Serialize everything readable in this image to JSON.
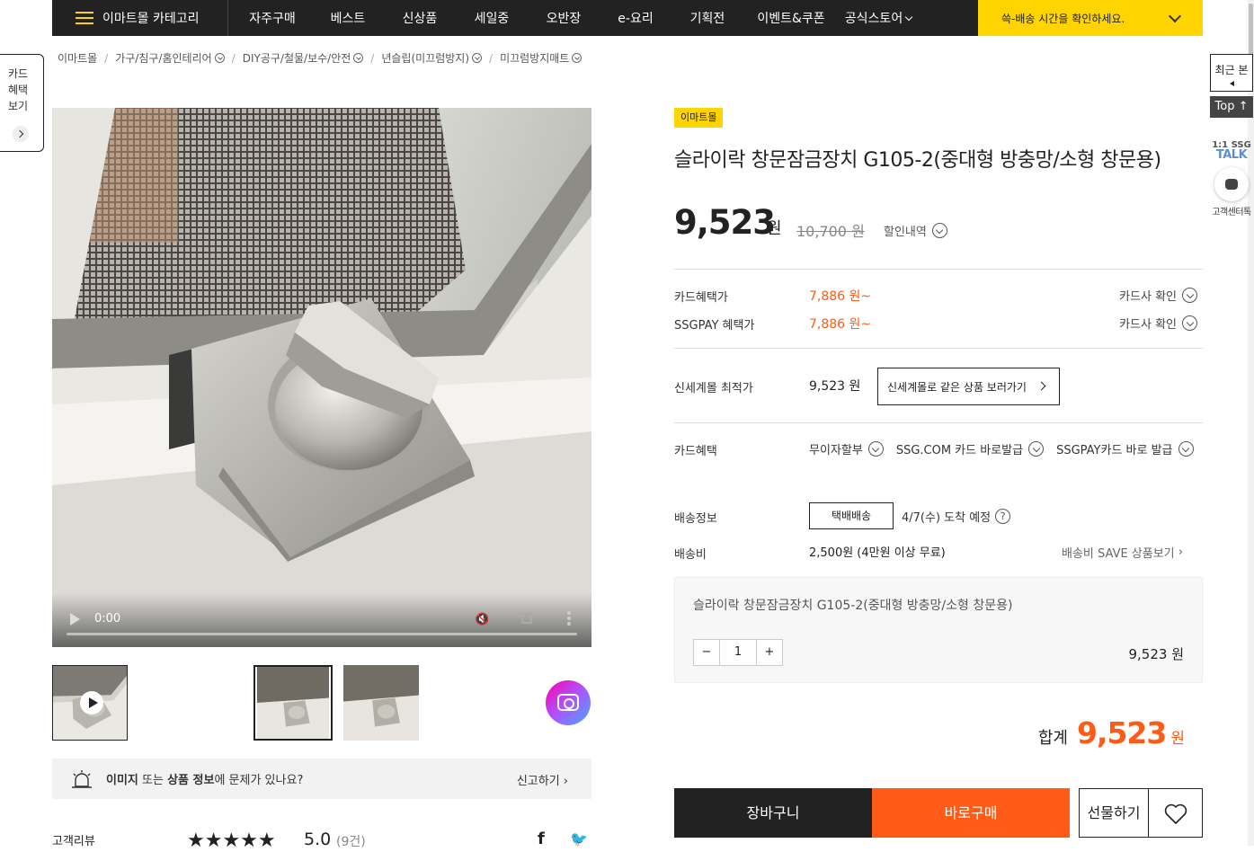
{
  "header": {
    "category_label": "이마트몰 카테고리",
    "nav": [
      "자주구매",
      "베스트",
      "신상품",
      "세일중",
      "오반장",
      "e-요리",
      "기획전",
      "이벤트&쿠폰",
      "공식스토어"
    ],
    "delivery_banner": "쓱-배송 시간을 확인하세요."
  },
  "breadcrumb": [
    "이마트몰",
    "가구/침구/홈인테리어",
    "DIY공구/철물/보수/안전",
    "년슬립(미끄럼방지)",
    "미끄럼방지매트"
  ],
  "card_benefit_tab": [
    "카드",
    "혜택",
    "보기"
  ],
  "video": {
    "time": "0:00"
  },
  "report": {
    "b1": "이미지",
    "t1": " 또는 ",
    "b2": "상품 정보",
    "t2": "에 문제가 있나요?",
    "link": "신고하기"
  },
  "review": {
    "label": "고객리뷰",
    "stars": "★★★★★",
    "score": "5.0",
    "count": "(9건)"
  },
  "product": {
    "badge": "이마트몰",
    "title": "슬라이락 창문잠금장치 G105-2(중대형 방충망/소형 창문용)",
    "price": "9,523",
    "price_unit": "원",
    "original_price": "10,700",
    "original_unit": "원",
    "discount_link": "할인내역",
    "card_price_label": "카드혜택가",
    "card_price": "7,886 원~",
    "card_check": "카드사 확인",
    "ssgpay_label": "SSGPAY 혜택가",
    "ssgpay_price": "7,886 원~",
    "ssgpay_check": "카드사 확인",
    "lowest_label": "신세계몰 최적가",
    "lowest_price": "9,523 원",
    "same_product_btn": "신세계몰로 같은 상품 보러가기",
    "card_benefit_label": "카드혜택",
    "card_benefits": [
      "무이자할부",
      "SSG.COM 카드 바로발급",
      "SSGPAY카드 바로 발급"
    ],
    "shipping_label": "배송정보",
    "shipping_type": "택배배송",
    "shipping_date": "4/7(수) 도착 예정",
    "shipping_fee_label": "배송비",
    "shipping_fee": "2,500원 (4만원 이상 무료)",
    "shipping_save": "배송비 SAVE 상품보기",
    "option_name": "슬라이락 창문잠금장치 G105-2(중대형 방충망/소형 창문용)",
    "qty_minus": "−",
    "quantity": "1",
    "qty_plus": "+",
    "option_price": "9,523 원",
    "total_label": "합계",
    "total_price": "9,523",
    "total_unit": "원",
    "cart_btn": "장바구니",
    "buy_btn": "바로구매",
    "gift_btn": "선물하기"
  },
  "sidebar": {
    "recent": "최근 본",
    "top": "Top",
    "talk_top": "1:1 SSG",
    "talk": "TALK",
    "customer_center": "고객센터톡"
  },
  "colors": {
    "accent": "#ff5b16",
    "brand_yellow": "#ffd400",
    "dark": "#222222"
  }
}
